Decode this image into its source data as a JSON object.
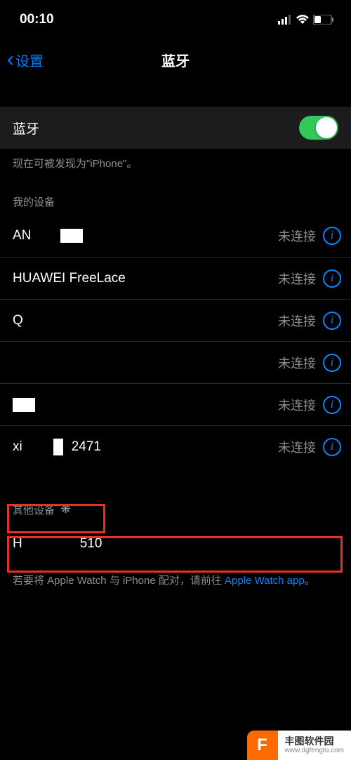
{
  "statusBar": {
    "time": "00:10"
  },
  "nav": {
    "back": "设置",
    "title": "蓝牙"
  },
  "bluetooth": {
    "label": "蓝牙",
    "discoverable": "现在可被发现为\"iPhone\"。"
  },
  "myDevices": {
    "header": "我的设备",
    "items": [
      {
        "name": "AN",
        "status": "未连接"
      },
      {
        "name": "HUAWEI FreeLace",
        "status": "未连接"
      },
      {
        "name": "Q",
        "status": "未连接"
      },
      {
        "name": "",
        "status": "未连接"
      },
      {
        "name": "",
        "status": "未连接"
      },
      {
        "name_prefix": "xi",
        "name_suffix": "2471",
        "status": "未连接"
      }
    ]
  },
  "otherDevices": {
    "header": "其他设备",
    "item_prefix": "H",
    "item_suffix": "510"
  },
  "watchNote": {
    "text_a": "若要将 Apple Watch 与 iPhone 配对，请前往 ",
    "link": "Apple Watch app",
    "text_b": "。"
  },
  "watermark": {
    "title": "丰图软件园",
    "url": "www.dgfengtu.com"
  }
}
